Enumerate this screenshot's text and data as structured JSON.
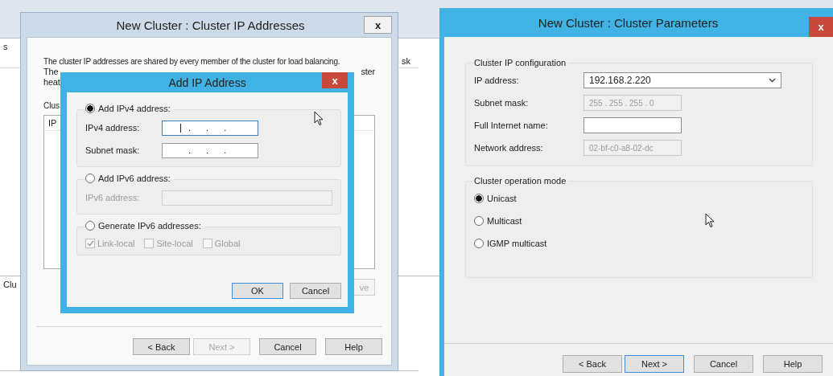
{
  "left_screen": {
    "background_window": {
      "side_text": "s",
      "column_text": "sk",
      "bottom_text": "Clu"
    },
    "cluster_ip_dialog": {
      "title": "New Cluster : Cluster IP Addresses",
      "close": "x",
      "intro": "The cluster IP addresses are shared by every member of the cluster for load balancing.",
      "intro_line_2_start": "The",
      "intro_line_2_end": "ster",
      "intro_line_3_start": "heat",
      "list_label": "Clus",
      "list_header": "IP",
      "remove_button": {
        "label": "ve",
        "disabled": true
      },
      "buttons": [
        {
          "label": "< Back",
          "disabled": false
        },
        {
          "label": "Next >",
          "disabled": true
        },
        {
          "label": "Cancel",
          "disabled": false
        },
        {
          "label": "Help",
          "disabled": false
        }
      ]
    },
    "add_ip_dialog": {
      "title": "Add IP Address",
      "close": "x",
      "options": [
        {
          "kind": "fields",
          "label": "Add IPv4 address:",
          "selected": true,
          "fields": [
            {
              "kind": "ip",
              "label": "IPv4 address:",
              "value": ". . .",
              "focused": true,
              "disabled": false
            },
            {
              "kind": "ip",
              "label": "Subnet mask:",
              "value": ". . .",
              "focused": false,
              "disabled": false
            }
          ]
        },
        {
          "kind": "fields",
          "label": "Add IPv6 address:",
          "selected": false,
          "fields": [
            {
              "kind": "text",
              "label": "IPv6 address:",
              "focused": false,
              "disabled": true
            }
          ]
        },
        {
          "kind": "checkboxes",
          "label": "Generate IPv6 addresses:",
          "selected": false,
          "checkboxes": [
            {
              "label": "Link-local",
              "checked": true,
              "disabled": true
            },
            {
              "label": "Site-local",
              "checked": false,
              "disabled": true
            },
            {
              "label": "Global",
              "checked": false,
              "disabled": true
            }
          ]
        }
      ],
      "buttons": [
        {
          "label": "OK",
          "default": true
        },
        {
          "label": "Cancel",
          "default": false
        }
      ]
    }
  },
  "right_screen": {
    "dialog": {
      "title": "New Cluster : Cluster Parameters",
      "close": "x",
      "ip_configuration": {
        "legend": "Cluster IP configuration",
        "fields": [
          {
            "kind": "combo",
            "label": "IP address:",
            "value": "192.168.2.220",
            "disabled": false
          },
          {
            "kind": "text",
            "label": "Subnet mask:",
            "value": "255 . 255 . 255 . 0",
            "disabled": true
          },
          {
            "kind": "text",
            "label": "Full Internet name:",
            "disabled": false
          },
          {
            "kind": "text",
            "label": "Network address:",
            "value": "02-bf-c0-a8-02-dc",
            "disabled": true
          }
        ]
      },
      "operation_mode": {
        "legend": "Cluster operation mode",
        "options": [
          {
            "label": "Unicast",
            "selected": true
          },
          {
            "label": "Multicast",
            "selected": false
          },
          {
            "label": "IGMP multicast",
            "selected": false
          }
        ]
      },
      "buttons": [
        {
          "label": "< Back",
          "disabled": false,
          "default": false
        },
        {
          "label": "Next >",
          "disabled": false,
          "default": true
        },
        {
          "label": "Cancel",
          "disabled": false,
          "default": false
        },
        {
          "label": "Help",
          "disabled": false,
          "default": false
        }
      ]
    }
  }
}
